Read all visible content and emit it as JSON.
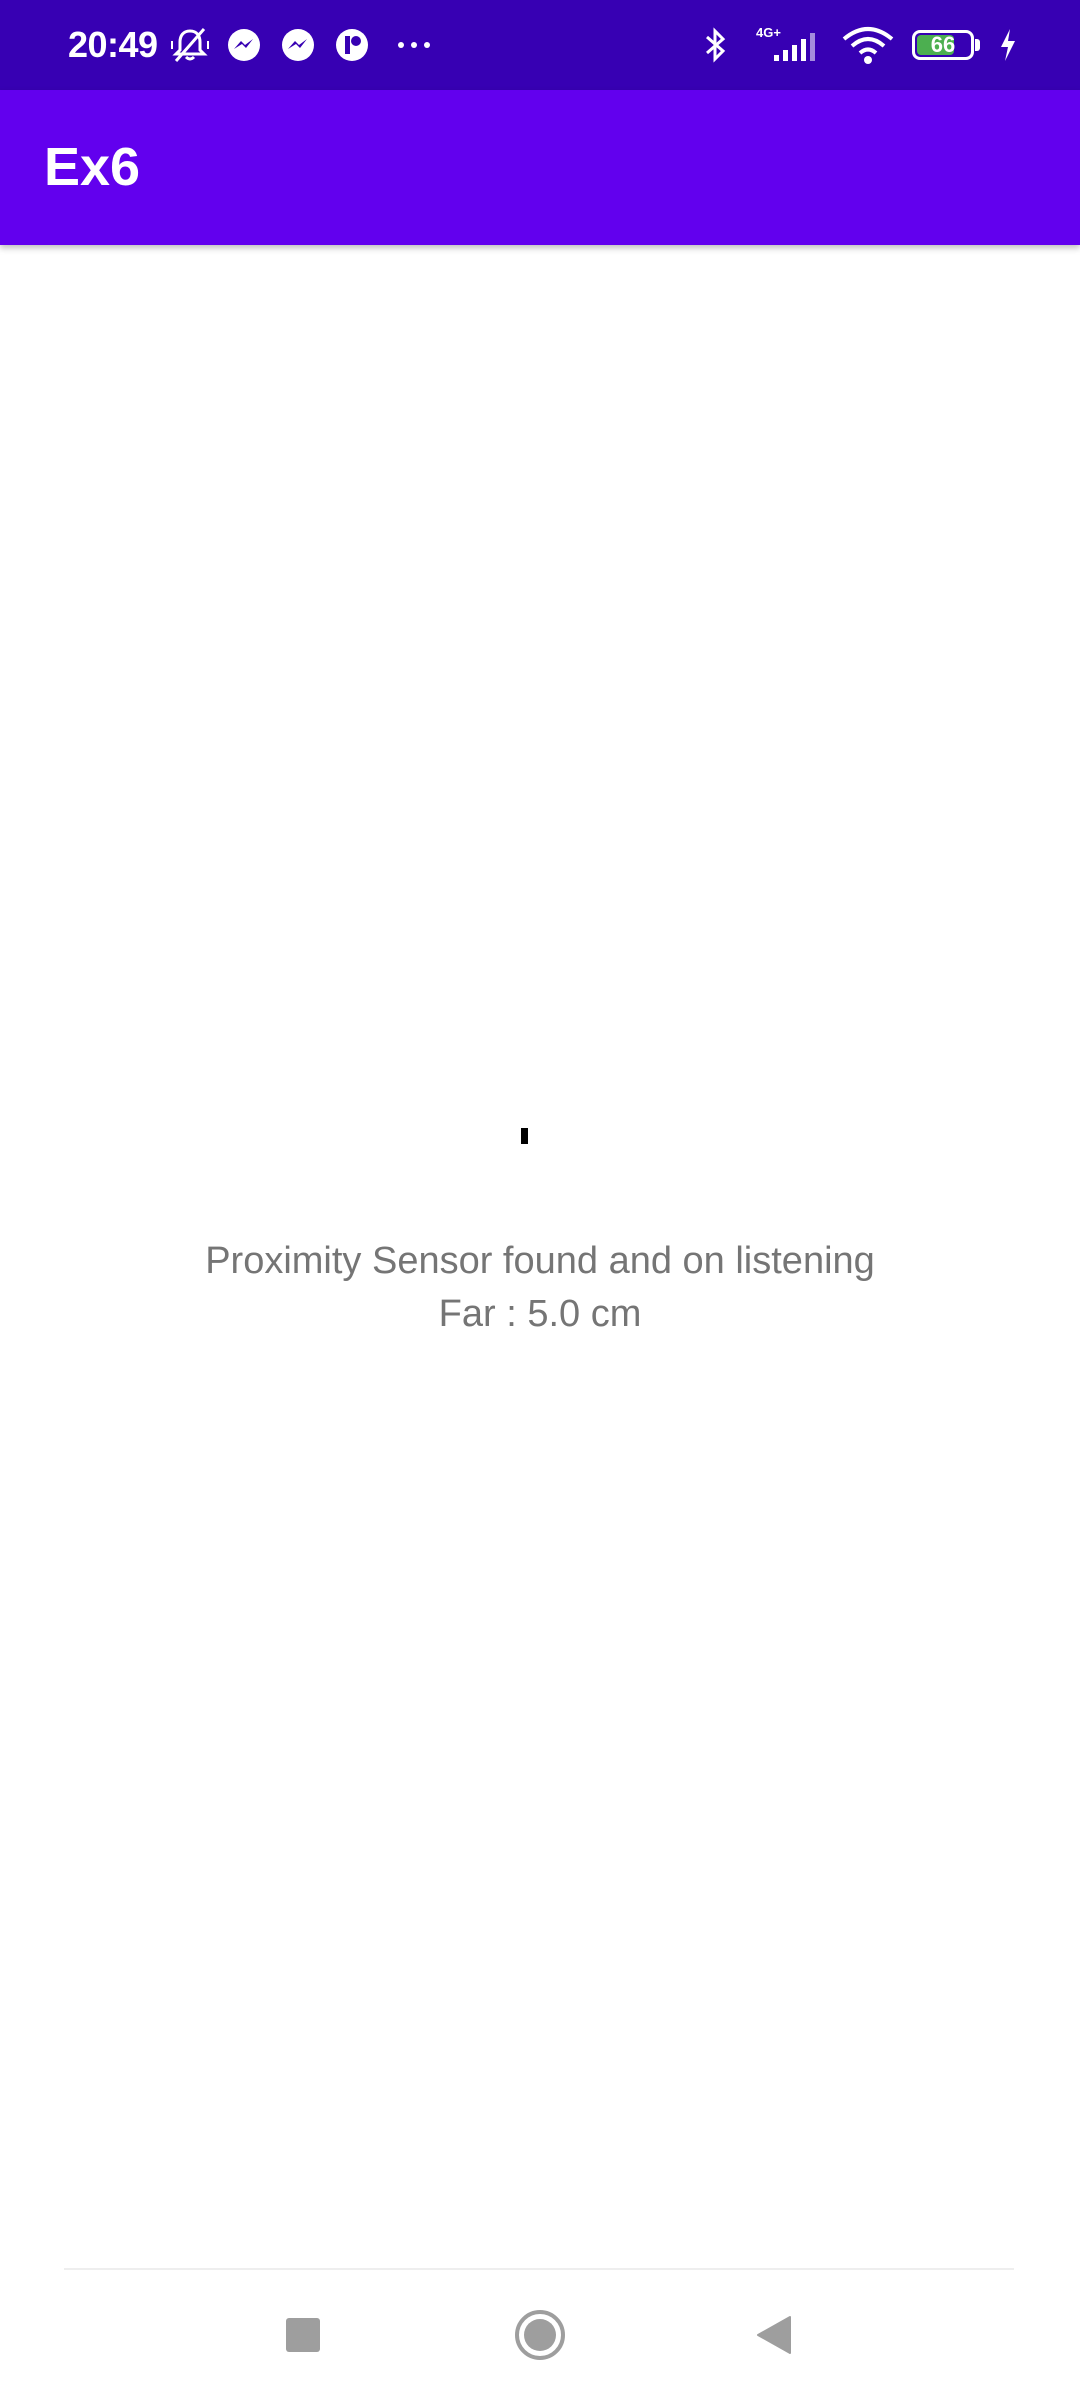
{
  "status_bar": {
    "time": "20:49",
    "battery_level": "66",
    "network_label": "4G+",
    "colors": {
      "background": "#3700B3",
      "battery_fill": "#4CAF50"
    },
    "left_icons": [
      "mute-icon",
      "messenger-icon",
      "messenger-icon",
      "app-notification-icon",
      "more-dots-icon"
    ],
    "right_icons": [
      "bluetooth-icon",
      "cellular-signal-icon",
      "wifi-icon",
      "battery-icon",
      "charging-icon"
    ]
  },
  "app_bar": {
    "title": "Ex6",
    "color": "#6200EE"
  },
  "main": {
    "status_line": "Proximity Sensor found and on listening",
    "reading_line": "Far : 5.0 cm",
    "text_color": "#757575"
  },
  "nav_bar": {
    "buttons": [
      "recents-square-icon",
      "home-circle-icon",
      "back-triangle-icon"
    ]
  }
}
